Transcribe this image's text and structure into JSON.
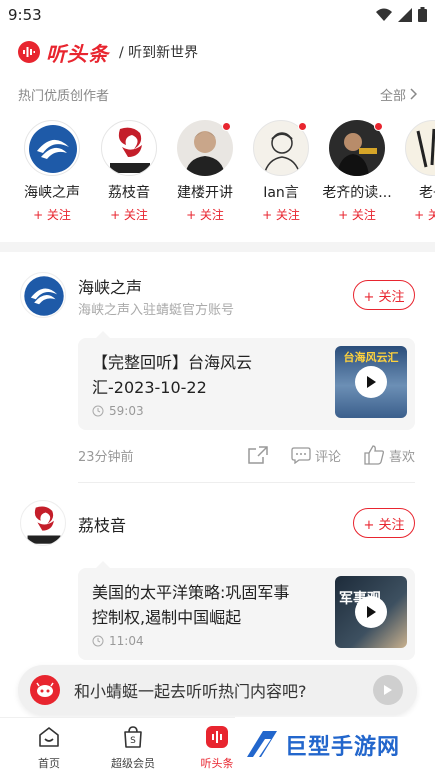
{
  "status_bar": {
    "time": "9:53"
  },
  "header": {
    "brand_name": "听头条",
    "slogan": "/ 听到新世界"
  },
  "creators_section": {
    "title": "热门优质创作者",
    "more_label": "全部",
    "follow_label": "+ 关注",
    "items": [
      {
        "name": "海峡之声",
        "has_dot": false
      },
      {
        "name": "荔枝音",
        "has_dot": false
      },
      {
        "name": "建楼开讲",
        "has_dot": true
      },
      {
        "name": "Ian言",
        "has_dot": true
      },
      {
        "name": "老齐的读...",
        "has_dot": true
      },
      {
        "name": "老子",
        "has_dot": false
      }
    ]
  },
  "feed": [
    {
      "author": "海峡之声",
      "subtitle": "海峡之声入驻蜻蜓官方账号",
      "follow_label": "+ 关注",
      "card_title": "【完整回听】台海风云汇-2023-10-22",
      "duration": "59:03",
      "thumb_caption": "台海风云汇",
      "time_ago": "23分钟前",
      "comment_label": "评论",
      "like_label": "喜欢"
    },
    {
      "author": "荔枝音",
      "subtitle": "",
      "follow_label": "+ 关注",
      "card_title": "美国的太平洋策略:巩固军事控制权,遏制中国崛起",
      "duration": "11:04",
      "thumb_caption": "军事观"
    }
  ],
  "mini_player": {
    "text": "和小蜻蜓一起去听听热门内容吧?"
  },
  "bottom_nav": {
    "items": [
      {
        "label": "首页"
      },
      {
        "label": "超级会员"
      },
      {
        "label": "听头条"
      }
    ]
  },
  "watermark": {
    "text": "巨型手游网"
  },
  "colors": {
    "accent": "#e8252f",
    "watermark_blue": "#2266cc"
  }
}
